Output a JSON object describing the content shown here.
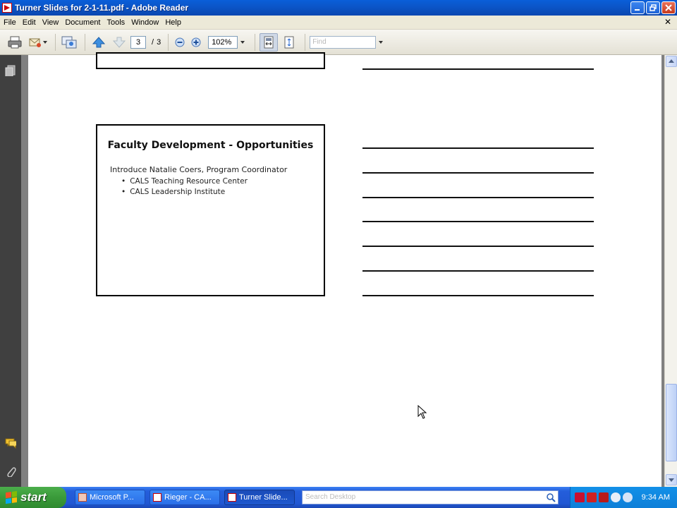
{
  "window": {
    "title": "Turner Slides for 2-1-11.pdf - Adobe Reader"
  },
  "menu": [
    "File",
    "Edit",
    "View",
    "Document",
    "Tools",
    "Window",
    "Help"
  ],
  "toolbar": {
    "current_page": "3",
    "page_separator": "/",
    "total_pages": "3",
    "zoom": "102%",
    "find_placeholder": "Find"
  },
  "slide": {
    "title": "Faculty Development - Opportunities",
    "subtitle": "Introduce Natalie Coers, Program Coordinator",
    "bullets": [
      "CALS Teaching Resource Center",
      "CALS Leadership Institute"
    ]
  },
  "taskbar": {
    "start_label": "start",
    "tasks": [
      {
        "label": "Microsoft P...",
        "active": false
      },
      {
        "label": "Rieger - CA...",
        "active": false
      },
      {
        "label": "Turner Slide...",
        "active": true
      }
    ],
    "search_placeholder": "Search Desktop",
    "clock": "9:34 AM"
  },
  "colors": {
    "titlebar": "#0b56c9",
    "taskbar": "#245edb",
    "start": "#3a9a3a",
    "document_bg": "#808080",
    "nav_bg": "#404040"
  }
}
